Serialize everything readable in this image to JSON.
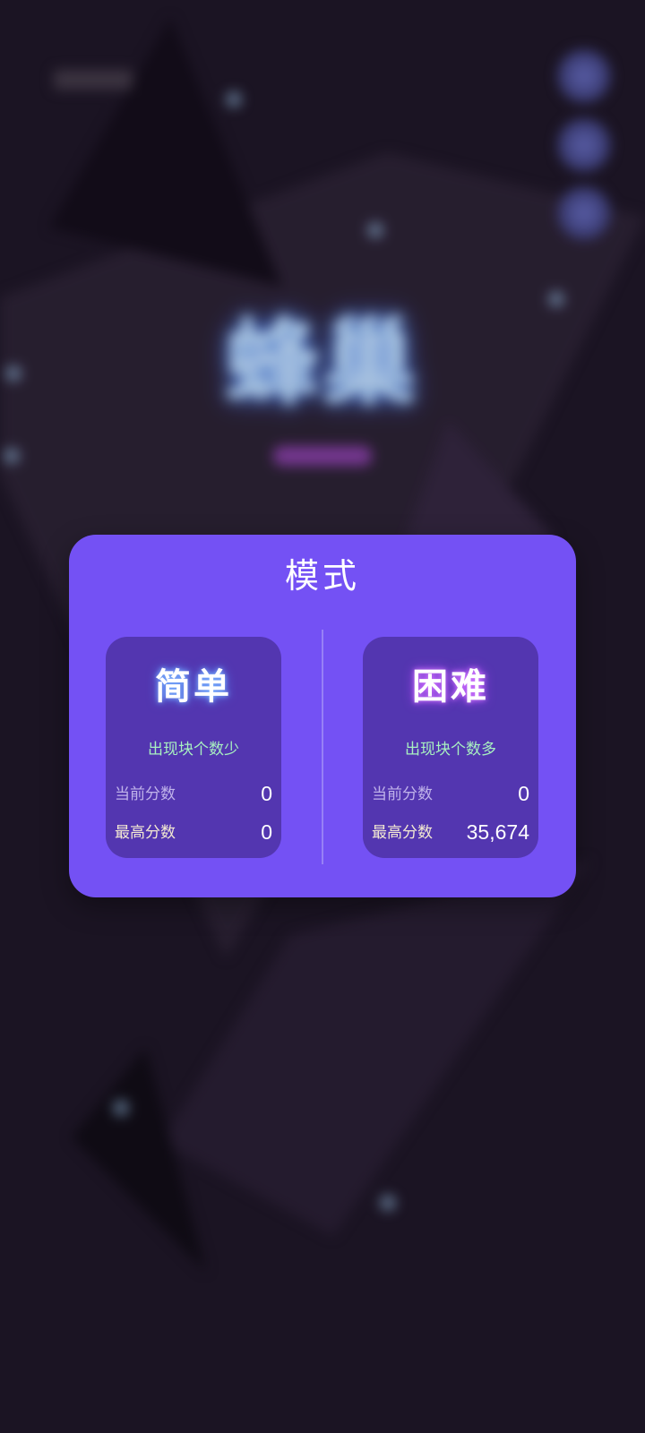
{
  "background": {
    "title": "蜂巢"
  },
  "modal": {
    "title": "模式",
    "modes": [
      {
        "name": "简单",
        "description": "出现块个数少",
        "current_label": "当前分数",
        "current_value": "0",
        "best_label": "最高分数",
        "best_value": "0"
      },
      {
        "name": "困难",
        "description": "出现块个数多",
        "current_label": "当前分数",
        "current_value": "0",
        "best_label": "最高分数",
        "best_value": "35,674"
      }
    ]
  },
  "colors": {
    "card_bg": "#7451f4",
    "mode_box_bg": "#5336b0",
    "desc_green": "#a8f0c0",
    "page_bg": "#1b1423"
  }
}
